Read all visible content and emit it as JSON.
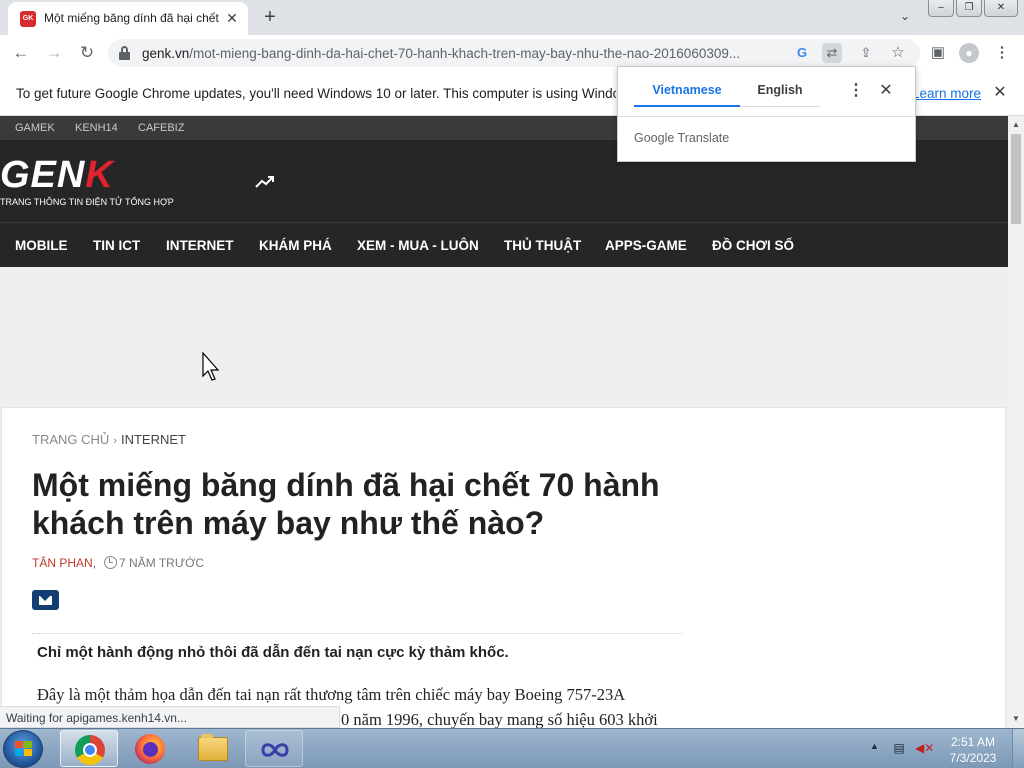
{
  "browser": {
    "tab_title": "Một miếng băng dính đã hại chết",
    "tab_favicon": "GK",
    "url_host": "genk.vn",
    "url_path": "/mot-mieng-bang-dinh-da-hai-chet-70-hanh-khach-tren-may-bay-nhu-the-nao-2016060309...",
    "icons": {
      "back": "←",
      "forward": "→",
      "reload": "↻",
      "new_tab": "+",
      "close": "✕",
      "tab_search": "⌄",
      "share": "⇪",
      "bookmark": "☆",
      "side_panel": "▣",
      "menu": "⋮",
      "google": "G",
      "translate": "⇄"
    }
  },
  "infobar": {
    "message": "To get future Google Chrome updates, you'll need Windows 10 or later. This computer is using Windows 7.",
    "link": "Learn more"
  },
  "translate": {
    "source_lang": "Vietnamese",
    "target_lang": "English",
    "brand": "Google Translate",
    "menu": "⋮",
    "close": "✕"
  },
  "site": {
    "top_links": [
      "GAMEK",
      "KENH14",
      "CAFEBIZ"
    ],
    "logo_main": "GEN",
    "logo_accent": "K",
    "tagline": "TRANG THÔNG TIN ĐIỆN TỬ TỔNG HỢP",
    "nav": [
      "MOBILE",
      "TIN ICT",
      "INTERNET",
      "KHÁM PHÁ",
      "XEM - MUA - LUÔN",
      "THỦ THUẬT",
      "APPS-GAME",
      "ĐỒ CHƠI SỐ"
    ]
  },
  "article": {
    "breadcrumb_home": "TRANG CHỦ",
    "breadcrumb_sep": "›",
    "breadcrumb_category": "INTERNET",
    "title": "Một miếng băng dính đã hại chết 70 hành khách trên máy bay như thế nào?",
    "author": "TÂN PHAN",
    "author_sep": ",",
    "time": "7 NĂM TRƯỚC",
    "sapo": "Chỉ một hành động nhỏ thôi đã dẫn đến tai nạn cực kỳ thảm khốc.",
    "body_line1": "Đây là một thảm họa dẫn đến tai nạn rất thương tâm trên chiếc máy bay Boeing 757-23A",
    "body_line2": "0 năm 1996, chuyến bay mang số hiệu 603 khởi"
  },
  "status": "Waiting for apigames.kenh14.vn...",
  "taskbar": {
    "time": "2:51 AM",
    "date": "7/3/2023",
    "tray_up": "▲"
  }
}
